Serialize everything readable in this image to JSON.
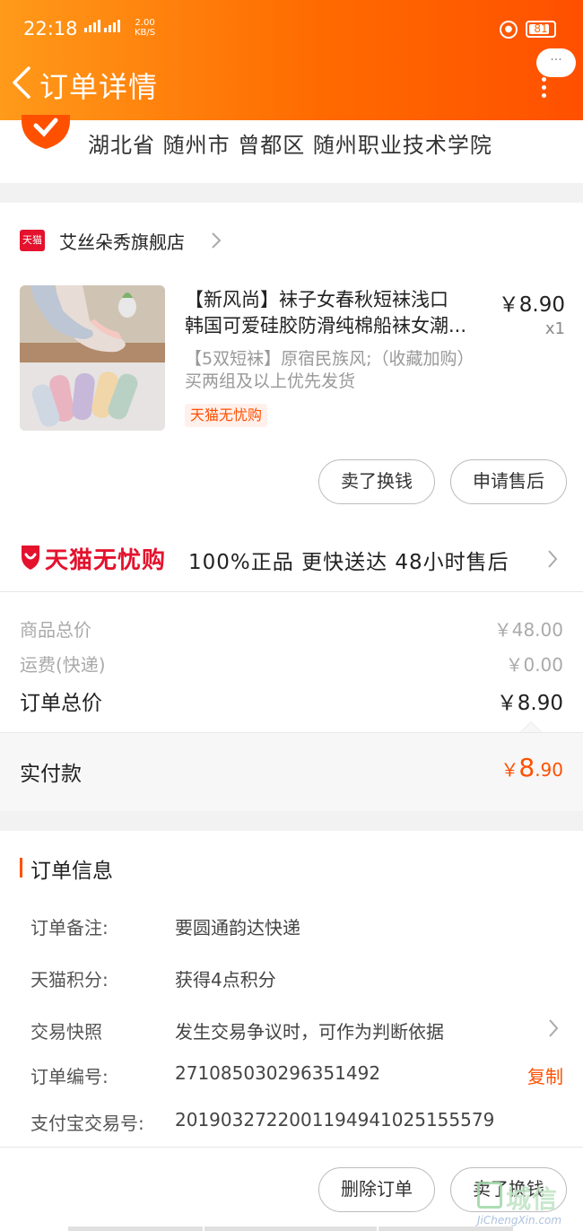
{
  "status_bar": {
    "time": "22:18",
    "net1": "4G",
    "net2": "2G",
    "speed_value": "2.00",
    "speed_unit": "KB/S",
    "battery": "81"
  },
  "header": {
    "title": "订单详情",
    "more": "···"
  },
  "address": {
    "text": "湖北省 随州市 曾都区 随州职业技术学院"
  },
  "shop": {
    "badge": "天猫",
    "name": "艾丝朵秀旗舰店"
  },
  "product": {
    "title_line1": "【新风尚】袜子女春秋短袜浅口",
    "title_line2": "韩国可爱硅胶防滑纯棉船袜女潮...",
    "price": "￥8.90",
    "qty": "x1",
    "sku": "【5双短袜】原宿民族风;（收藏加购）买两组及以上优先发货",
    "tag": "天猫无忧购",
    "btn_sell": "卖了换钱",
    "btn_after_sale": "申请售后"
  },
  "worry_free": {
    "brand": "天猫无忧购",
    "text": "100%正品  更快送达  48小时售后"
  },
  "summary": {
    "goods_label": "商品总价",
    "goods_value": "￥48.00",
    "shipping_label": "运费(快递)",
    "shipping_value": "￥0.00",
    "total_label": "订单总价",
    "total_value": "￥8.90",
    "paid_label": "实付款",
    "paid_symbol": "￥",
    "paid_int": "8",
    "paid_dec": ".90"
  },
  "order_info": {
    "title": "订单信息",
    "rows": [
      {
        "key": "订单备注:",
        "value": "要圆通韵达快递"
      },
      {
        "key": "天猫积分:",
        "value": "获得4点积分"
      },
      {
        "key": "交易快照",
        "value": "发生交易争议时，可作为判断依据"
      },
      {
        "key": "订单编号:",
        "value": "271085030296351492",
        "action": "复制"
      },
      {
        "key": "支付宝交易号:",
        "value": "2019032722001194941025155579"
      }
    ]
  },
  "bottom": {
    "btn_delete": "删除订单",
    "btn_sell": "卖了换钱",
    "watermark_cn": "城信",
    "watermark_en": "JiChengXin.com"
  },
  "colors": {
    "accent": "#ff5000",
    "header_start": "#ff9a1a",
    "tmall_red": "#e4122d"
  }
}
